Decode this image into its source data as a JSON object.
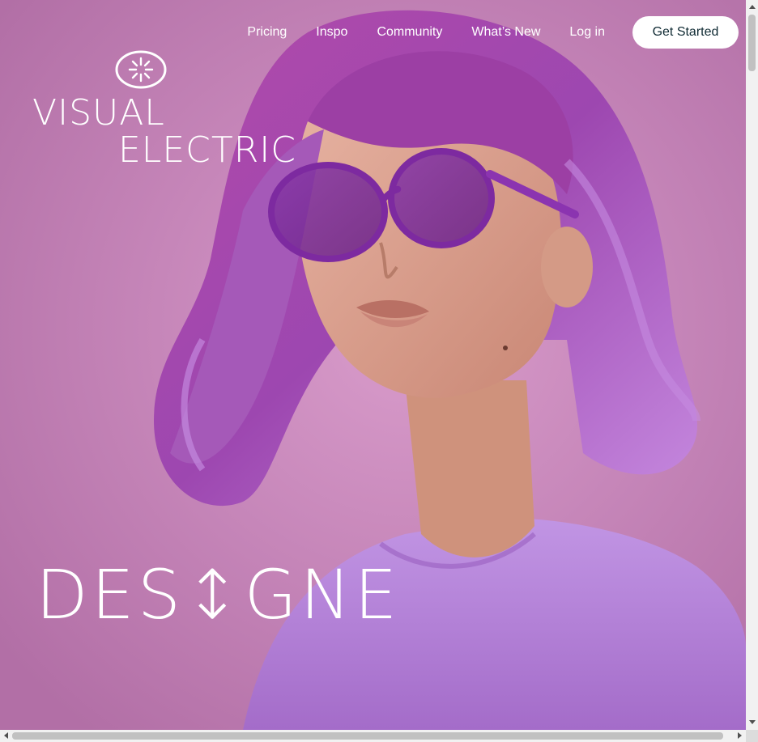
{
  "nav": {
    "links": [
      "Pricing",
      "Inspo",
      "Community",
      "What’s New",
      "Log in"
    ],
    "cta_label": "Get Started"
  },
  "logo": {
    "line1": "VISUAL",
    "line2": "ELECTRIC"
  },
  "hero": {
    "headline": "DES↕GNE",
    "image_icon": "woman-purple-hair-sunglasses-image"
  },
  "colors": {
    "background": "#c27fb2",
    "hair": "#9b3fa6",
    "shirt": "#b27bd6",
    "skin": "#d9a08a",
    "glasses": "#7a2a9e",
    "cta_text": "#0f2a33"
  },
  "scrollbars": {
    "vertical": "scrollbar-vertical",
    "horizontal": "scrollbar-horizontal"
  }
}
